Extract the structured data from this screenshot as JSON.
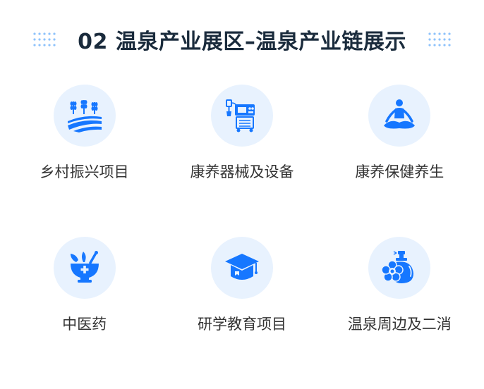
{
  "header": {
    "title": "02 温泉产业展区–温泉产业链展示"
  },
  "colors": {
    "accent": "#1677ff",
    "circle_bg": "#e8f2fe",
    "title": "#1a2b3c",
    "label": "#333333"
  },
  "items": [
    {
      "label": "乡村振兴项目",
      "icon": "wheat-field-icon"
    },
    {
      "label": "康养器械及设备",
      "icon": "medical-device-icon"
    },
    {
      "label": "康养保健养生",
      "icon": "meditation-icon"
    },
    {
      "label": "中医药",
      "icon": "mortar-pestle-icon"
    },
    {
      "label": "研学教育项目",
      "icon": "graduation-cap-icon"
    },
    {
      "label": "温泉周边及二消",
      "icon": "perfume-flower-icon"
    }
  ]
}
